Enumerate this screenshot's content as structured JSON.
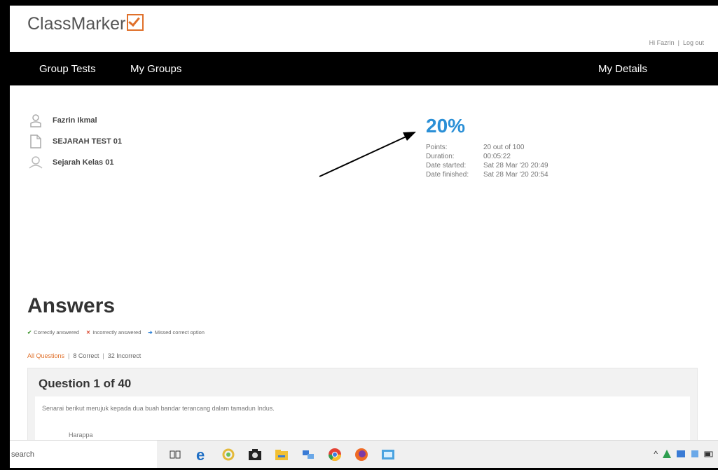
{
  "app": {
    "logo_text": "ClassMarker",
    "greeting": "Hi Fazrin",
    "logout_label": "Log out"
  },
  "nav": {
    "group_tests": "Group Tests",
    "my_groups": "My Groups",
    "my_details": "My Details"
  },
  "test_info": {
    "user_name": "Fazrin Ikmal",
    "test_name": "SEJARAH TEST 01",
    "group_name": "Sejarah Kelas 01"
  },
  "result": {
    "percentage": "20%",
    "points_label": "Points:",
    "points_value": "20 out of 100",
    "duration_label": "Duration:",
    "duration_value": "00:05:22",
    "started_label": "Date started:",
    "started_value": "Sat 28 Mar '20 20:49",
    "finished_label": "Date finished:",
    "finished_value": "Sat 28 Mar '20 20:54"
  },
  "answers": {
    "heading": "Answers",
    "legend_correct": "Correctly answered",
    "legend_incorrect": "Incorrectly answered",
    "legend_missed": "Missed correct option",
    "filter_all": "All Questions",
    "filter_correct": "8 Correct",
    "filter_incorrect": "32 Incorrect"
  },
  "question": {
    "title": "Question 1 of 40",
    "text": "Senarai berikut merujuk kepada dua buah bandar terancang dalam tamadun Indus.",
    "option_1": "Harappa"
  },
  "taskbar": {
    "search_text": "search",
    "icons": [
      "task-view-icon",
      "edge-icon",
      "photos-icon",
      "camera-icon",
      "files-icon",
      "network-icon",
      "chrome-icon",
      "firefox-icon",
      "app-icon"
    ],
    "tray_caret": "^"
  },
  "colors": {
    "accent_blue": "#2a8fd6",
    "orange": "#e0702a",
    "nav_bg": "#000000"
  }
}
